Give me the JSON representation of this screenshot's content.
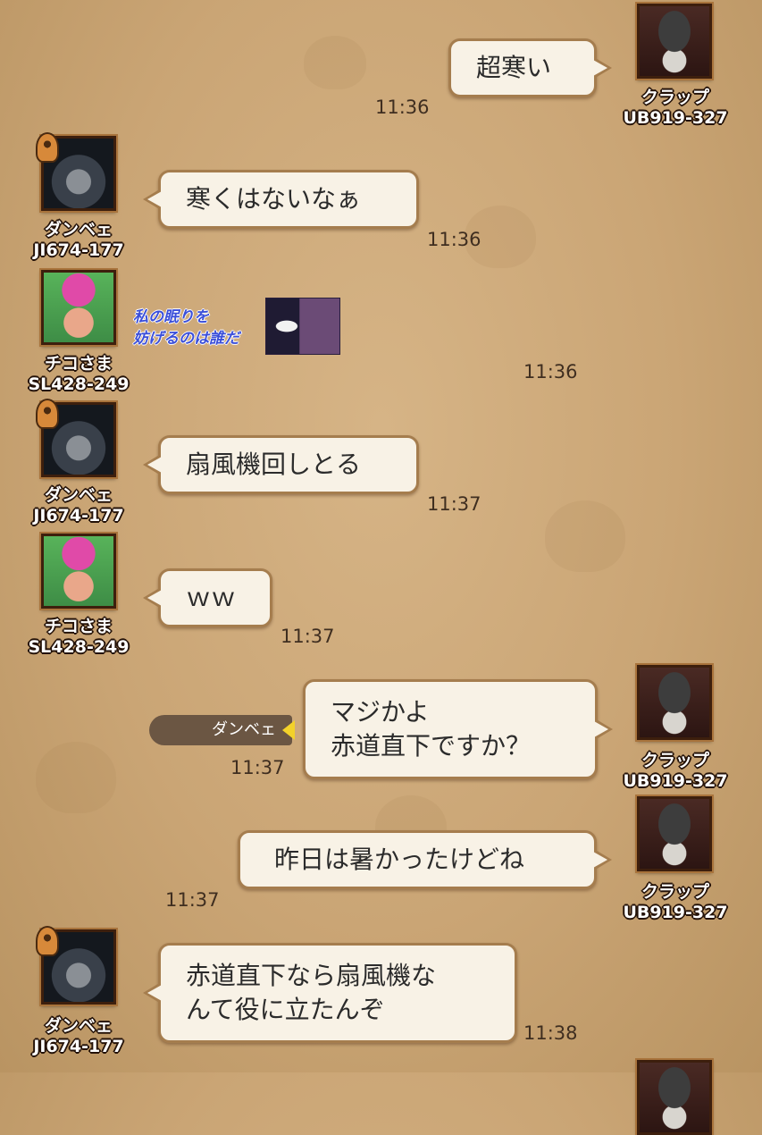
{
  "players": {
    "kurappu": {
      "name": "クラップ",
      "id": "UB919-327"
    },
    "danbe": {
      "name": "ダンベェ",
      "id": "JI674-177"
    },
    "chiko": {
      "name": "チコさま",
      "id": "SL428-249"
    }
  },
  "messages": [
    {
      "sender": "クラップ",
      "id": "UB919-327",
      "text": "超寒い",
      "time": "11:36"
    },
    {
      "sender": "ダンベェ",
      "id": "JI674-177",
      "text": "寒くはないなぁ",
      "time": "11:36"
    },
    {
      "sender": "チコさま",
      "id": "SL428-249",
      "stamp_text": "私の眠りを\n妨げるのは誰だ",
      "time": "11:36"
    },
    {
      "sender": "ダンベェ",
      "id": "JI674-177",
      "text": "扇風機回しとる",
      "time": "11:37"
    },
    {
      "sender": "チコさま",
      "id": "SL428-249",
      "text": "ｗｗ",
      "time": "11:37"
    },
    {
      "sender": "クラップ",
      "id": "UB919-327",
      "text": "マジかよ\n赤道直下ですか？",
      "time": "11:37",
      "reply_to": "ダンベェ"
    },
    {
      "sender": "クラップ",
      "id": "UB919-327",
      "text": "昨日は暑かったけどね",
      "time": "11:37"
    },
    {
      "sender": "ダンベェ",
      "id": "JI674-177",
      "text": "赤道直下なら扇風機な\nんて役に立たんぞ",
      "time": "11:38"
    }
  ],
  "icons": {
    "leader_badge": "lock-badge-icon",
    "reply_tag_pointer": "yellow-triangle-icon"
  },
  "colors": {
    "background": "#cfab7b",
    "bubble_fill": "#f8f2e6",
    "bubble_border": "#a57d4e",
    "reply_tag": "#6b5643",
    "stamp_text": "#3b4fd9"
  }
}
